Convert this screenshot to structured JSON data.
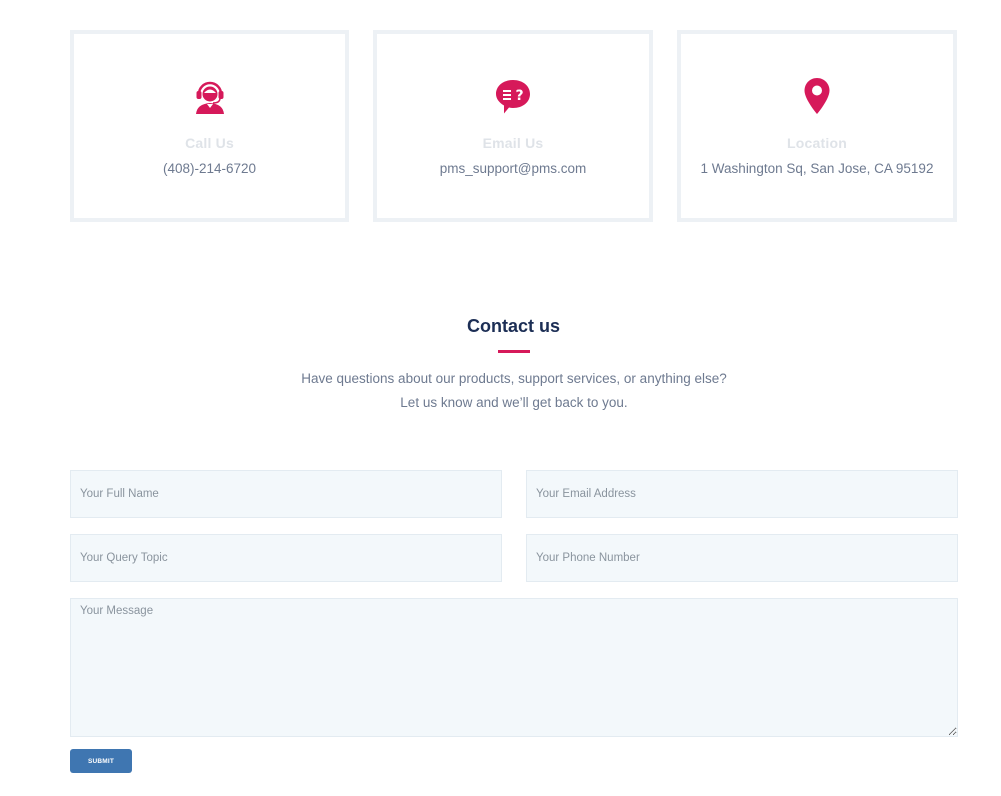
{
  "colors": {
    "accent": "#d6195a",
    "heading": "#1c2e55",
    "button": "#3f76b1",
    "field_bg": "#f3f8fb"
  },
  "cards": [
    {
      "icon": "headset-support-icon",
      "title": "Call Us",
      "value": "(408)-214-6720"
    },
    {
      "icon": "speech-bubble-question-icon",
      "title": "Email Us",
      "value": "pms_support@pms.com"
    },
    {
      "icon": "map-pin-icon",
      "title": "Location",
      "value": "1 Washington Sq, San Jose, CA 95192"
    }
  ],
  "contact": {
    "heading": "Contact us",
    "subtitle": "Have questions about our products, support services, or anything else? Let us know and we’ll get back to you."
  },
  "form": {
    "full_name_placeholder": "Your Full Name",
    "email_placeholder": "Your Email Address",
    "query_topic_placeholder": "Your Query Topic",
    "phone_placeholder": "Your Phone Number",
    "message_placeholder": "Your Message",
    "submit_label": "SUBMIT"
  }
}
